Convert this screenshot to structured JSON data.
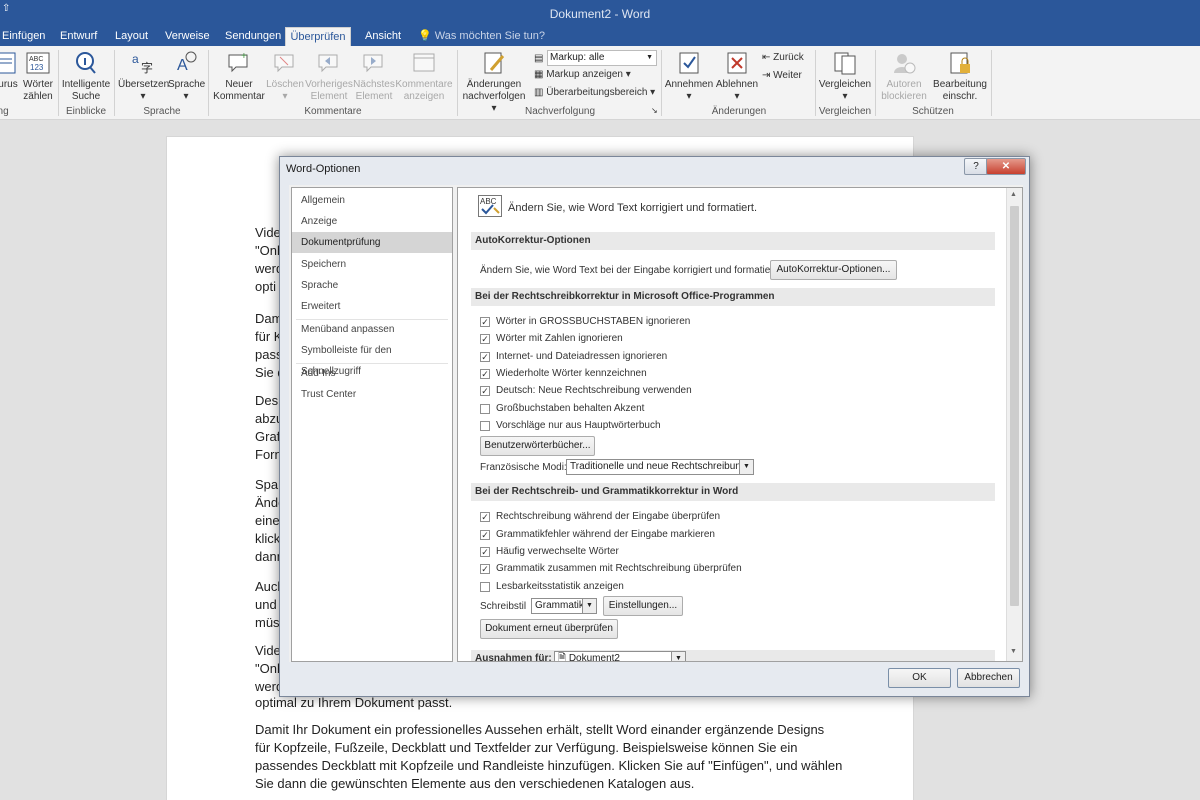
{
  "window": {
    "title": "Dokument2 - Word",
    "qat": "⇧"
  },
  "tabs": [
    {
      "label": "Einfügen"
    },
    {
      "label": "Entwurf"
    },
    {
      "label": "Layout"
    },
    {
      "label": "Verweise"
    },
    {
      "label": "Sendungen"
    },
    {
      "label": "Überprüfen"
    },
    {
      "label": "Ansicht"
    }
  ],
  "tellme": "Was möchten Sie tun?",
  "ribbon": {
    "thesaurus": "urus",
    "woerter_zaehlen": [
      "Wörter",
      "zählen"
    ],
    "intelligente_suche": [
      "Intelligente",
      "Suche"
    ],
    "uebersetzen": "Übersetzen",
    "sprache": "Sprache",
    "neuer_kommentar": [
      "Neuer",
      "Kommentar"
    ],
    "loeschen": "Löschen",
    "vorheriges": [
      "Vorheriges",
      "Element"
    ],
    "naechstes": [
      "Nächstes",
      "Element"
    ],
    "kommentare_anzeigen": [
      "Kommentare",
      "anzeigen"
    ],
    "aenderungen_nachverfolgen": [
      "Änderungen",
      "nachverfolgen"
    ],
    "markup_select": "Markup: alle",
    "markup_anzeigen": "Markup anzeigen",
    "ueberarbeitungsbereich": "Überarbeitungsbereich",
    "annehmen": "Annehmen",
    "ablehnen": "Ablehnen",
    "zurueck": "Zurück",
    "weiter": "Weiter",
    "vergleichen": "Vergleichen",
    "autoren_blockieren": [
      "Autoren",
      "blockieren"
    ],
    "bearbeitung": [
      "Bearbeitung",
      "einschr."
    ],
    "groups": {
      "g0": "ing",
      "einblicke": "Einblicke",
      "sprache": "Sprache",
      "kommentare": "Kommentare",
      "nachverfolgung": "Nachverfolgung",
      "aenderungen": "Änderungen",
      "vergleichen": "Vergleichen",
      "schuetzen": "Schützen"
    }
  },
  "document": {
    "left_fragments": [
      "Vide",
      "\"Onl",
      "werd",
      "opti",
      "Dam",
      "für K",
      "pass",
      "Sie d",
      "Desi",
      "abzu",
      "Graf",
      "Forn",
      "Spar",
      "Ände",
      "eine",
      "klick",
      "dann",
      "Auch",
      "und",
      "müs",
      "Vide",
      "\"Onl",
      "werd"
    ],
    "line_bottom_1": "optimal zu Ihrem Dokument passt.",
    "paragraph_2": [
      "Damit Ihr Dokument ein professionelles Aussehen erhält, stellt Word einander ergänzende Designs",
      "für Kopfzeile, Fußzeile, Deckblatt und Textfelder zur Verfügung. Beispielsweise können Sie ein",
      "passendes Deckblatt mit Kopfzeile und Randleiste hinzufügen. Klicken Sie auf \"Einfügen\", und wählen",
      "Sie dann die gewünschten Elemente aus den verschiedenen Katalogen aus."
    ]
  },
  "dialog": {
    "title": "Word-Optionen",
    "help": "?",
    "nav": [
      {
        "label": "Allgemein"
      },
      {
        "label": "Anzeige"
      },
      {
        "label": "Dokumentprüfung"
      },
      {
        "label": "Speichern"
      },
      {
        "label": "Sprache"
      },
      {
        "label": "Erweitert"
      },
      {
        "label": "Menüband anpassen"
      },
      {
        "label": "Symbolleiste für den Schnellzugriff"
      },
      {
        "label": "Add-Ins"
      },
      {
        "label": "Trust Center"
      }
    ],
    "intro": "Ändern Sie, wie Word Text korrigiert und formatiert.",
    "autocorrect_header": "AutoKorrektur-Optionen",
    "autocorrect_text": "Ändern Sie, wie Word Text bei der Eingabe korrigiert und formatiert:",
    "autocorrect_button": "AutoKorrektur-Optionen...",
    "spelling_header": "Bei der Rechtschreibkorrektur in Microsoft Office-Programmen",
    "spelling_options": [
      {
        "label": "Wörter in GROSSBUCHSTABEN ignorieren",
        "checked": "✓"
      },
      {
        "label": "Wörter mit Zahlen ignorieren",
        "checked": "✓"
      },
      {
        "label": "Internet- und Dateiadressen ignorieren",
        "checked": "✓"
      },
      {
        "label": "Wiederholte Wörter kennzeichnen",
        "checked": "✓"
      },
      {
        "label": "Deutsch: Neue Rechtschreibung verwenden",
        "checked": "✓"
      },
      {
        "label": "Großbuchstaben behalten Akzent",
        "checked": ""
      },
      {
        "label": "Vorschläge nur aus Hauptwörterbuch",
        "checked": ""
      }
    ],
    "custom_dict_button": "Benutzerwörterbücher...",
    "french_label": "Französische Modi:",
    "french_value": "Traditionelle und neue Rechtschreibung",
    "grammar_header": "Bei der Rechtschreib- und Grammatikkorrektur in Word",
    "grammar_options": [
      {
        "label": "Rechtschreibung während der Eingabe überprüfen",
        "checked": "✓"
      },
      {
        "label": "Grammatikfehler während der Eingabe markieren",
        "checked": "✓"
      },
      {
        "label": "Häufig verwechselte Wörter",
        "checked": "✓"
      },
      {
        "label": "Grammatik zusammen mit Rechtschreibung überprüfen",
        "checked": "✓"
      },
      {
        "label": "Lesbarkeitsstatistik anzeigen",
        "checked": ""
      }
    ],
    "style_label": "Schreibstil",
    "style_value": "Grammatik",
    "settings_button": "Einstellungen...",
    "recheck_button": "Dokument erneut überprüfen",
    "exceptions_label": "Ausnahmen für:",
    "exceptions_value": "Dokument2",
    "ok": "OK",
    "cancel": "Abbrechen"
  },
  "colors": {
    "accent": "#2b579a",
    "ribbon": "#f3f3f3",
    "dialog_frame": "#e6eaf0"
  }
}
